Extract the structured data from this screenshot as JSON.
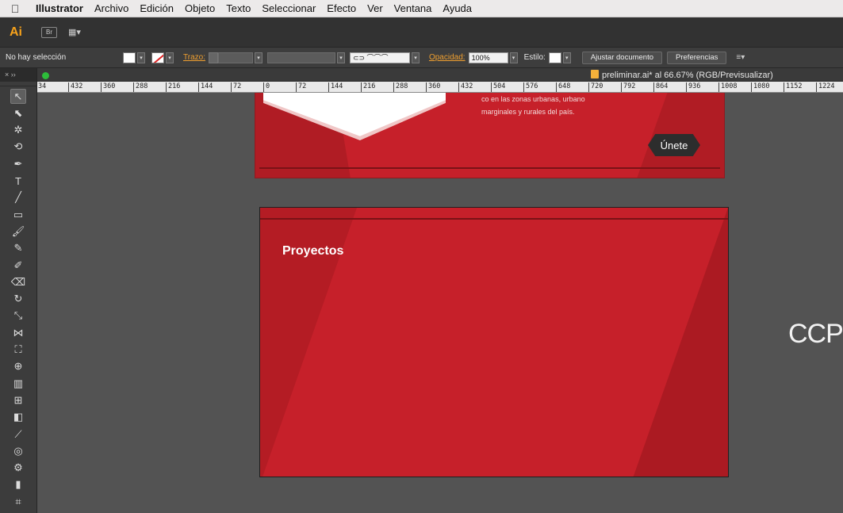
{
  "menubar": {
    "apple_icon": "apple-icon",
    "items": [
      "Illustrator",
      "Archivo",
      "Edición",
      "Objeto",
      "Texto",
      "Seleccionar",
      "Efecto",
      "Ver",
      "Ventana",
      "Ayuda"
    ]
  },
  "appbar": {
    "logo": "Ai",
    "bridge_label": "Br",
    "workspace_icon": "arrange-documents-icon"
  },
  "control_bar": {
    "selection_status": "No hay selección",
    "stroke_label": "Trazo:",
    "opacity_label": "Opacidad:",
    "opacity_value": "100%",
    "style_label": "Estilo:",
    "fit_document_button": "Ajustar documento",
    "preferences_button": "Preferencias"
  },
  "document_tab": {
    "title": "preliminar.ai* al 66.67% (RGB/Previsualizar)",
    "status_color": "#2dbd3a"
  },
  "ruler": {
    "labels": [
      "34",
      "432",
      "360",
      "288",
      "216",
      "144",
      "72",
      "0",
      "72",
      "144",
      "216",
      "288",
      "360",
      "432",
      "504",
      "576",
      "648",
      "720",
      "792",
      "864",
      "936",
      "1008",
      "1080",
      "1152",
      "1224"
    ]
  },
  "tools": [
    {
      "name": "selection-tool-icon",
      "glyph": "↖"
    },
    {
      "name": "direct-selection-tool-icon",
      "glyph": "⬉"
    },
    {
      "name": "magic-wand-tool-icon",
      "glyph": "✲"
    },
    {
      "name": "lasso-tool-icon",
      "glyph": "⟲"
    },
    {
      "name": "pen-tool-icon",
      "glyph": "✒"
    },
    {
      "name": "type-tool-icon",
      "glyph": "T"
    },
    {
      "name": "line-tool-icon",
      "glyph": "╱"
    },
    {
      "name": "rectangle-tool-icon",
      "glyph": "▭"
    },
    {
      "name": "paintbrush-tool-icon",
      "glyph": "🖌"
    },
    {
      "name": "pencil-tool-icon",
      "glyph": "✎"
    },
    {
      "name": "blob-brush-tool-icon",
      "glyph": "✐"
    },
    {
      "name": "eraser-tool-icon",
      "glyph": "⌫"
    },
    {
      "name": "rotate-tool-icon",
      "glyph": "↻"
    },
    {
      "name": "scale-tool-icon",
      "glyph": "⤡"
    },
    {
      "name": "width-tool-icon",
      "glyph": "⋈"
    },
    {
      "name": "free-transform-tool-icon",
      "glyph": "⛶"
    },
    {
      "name": "shape-builder-tool-icon",
      "glyph": "⊕"
    },
    {
      "name": "perspective-grid-tool-icon",
      "glyph": "▥"
    },
    {
      "name": "mesh-tool-icon",
      "glyph": "⊞"
    },
    {
      "name": "gradient-tool-icon",
      "glyph": "◧"
    },
    {
      "name": "eyedropper-tool-icon",
      "glyph": "⟋"
    },
    {
      "name": "blend-tool-icon",
      "glyph": "◎"
    },
    {
      "name": "symbol-sprayer-tool-icon",
      "glyph": "⚙"
    },
    {
      "name": "column-graph-tool-icon",
      "glyph": "▮"
    },
    {
      "name": "artboard-tool-icon",
      "glyph": "⌗"
    }
  ],
  "artboard_top": {
    "text_line1": "co en las zonas   urbanas, urbano",
    "text_line2": "marginales y rurales del país.",
    "join_button": "Únete",
    "fill_color": "#c6202a"
  },
  "artboard_projects": {
    "heading": "Proyectos",
    "fill_color": "#c6202a"
  },
  "canvas_text": {
    "partial_logo": "CCP"
  },
  "accent_color": "#f7a21b"
}
